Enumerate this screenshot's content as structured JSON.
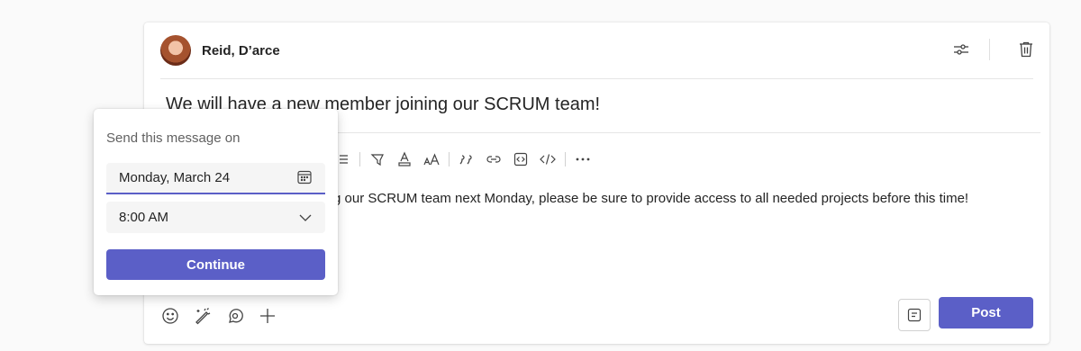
{
  "author": {
    "name": "Reid, D’arce"
  },
  "message": {
    "subject": "We will have a new member joining our SCRUM team!",
    "body": "g our SCRUM team next Monday, please be sure to provide access to all needed projects before this time!"
  },
  "actions": {
    "post_label": "Post"
  },
  "schedule_popover": {
    "title": "Send this message on",
    "date_value": "Monday, March 24",
    "time_value": "8:00 AM",
    "continue_label": "Continue"
  },
  "toolbar_icons": [
    "list-icon",
    "highlight-icon",
    "font-color-icon",
    "font-size-icon",
    "quote-icon",
    "link-icon",
    "code-snippet-icon",
    "code-icon",
    "more-icon"
  ],
  "footer_icons": [
    "emoji-icon",
    "magic-wand-icon",
    "loop-icon",
    "add-icon"
  ],
  "colors": {
    "accent": "#5b5fc7",
    "text": "#242424",
    "muted": "#616161",
    "field_bg": "#f5f5f5"
  }
}
